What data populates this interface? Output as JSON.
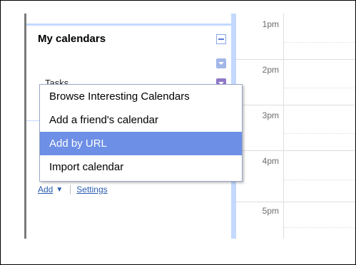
{
  "sidebar": {
    "section_title": "My calendars",
    "calendars": [
      {
        "label": "",
        "color": "#a2b6e8"
      },
      {
        "label": "Tasks",
        "color": "#8f78c7"
      }
    ],
    "footer": {
      "add_label": "Add",
      "settings_label": "Settings"
    }
  },
  "add_menu": {
    "items": [
      {
        "label": "Browse Interesting Calendars",
        "active": false
      },
      {
        "label": "Add a friend's calendar",
        "active": false
      },
      {
        "label": "Add by URL",
        "active": true
      },
      {
        "label": "Import calendar",
        "active": false
      }
    ]
  },
  "day_view": {
    "hours": [
      "1pm",
      "2pm",
      "3pm",
      "4pm",
      "5pm"
    ]
  },
  "colors": {
    "accent_border": "#c3d9ff",
    "link": "#2a5db0",
    "menu_highlight": "#6d8fe6"
  }
}
